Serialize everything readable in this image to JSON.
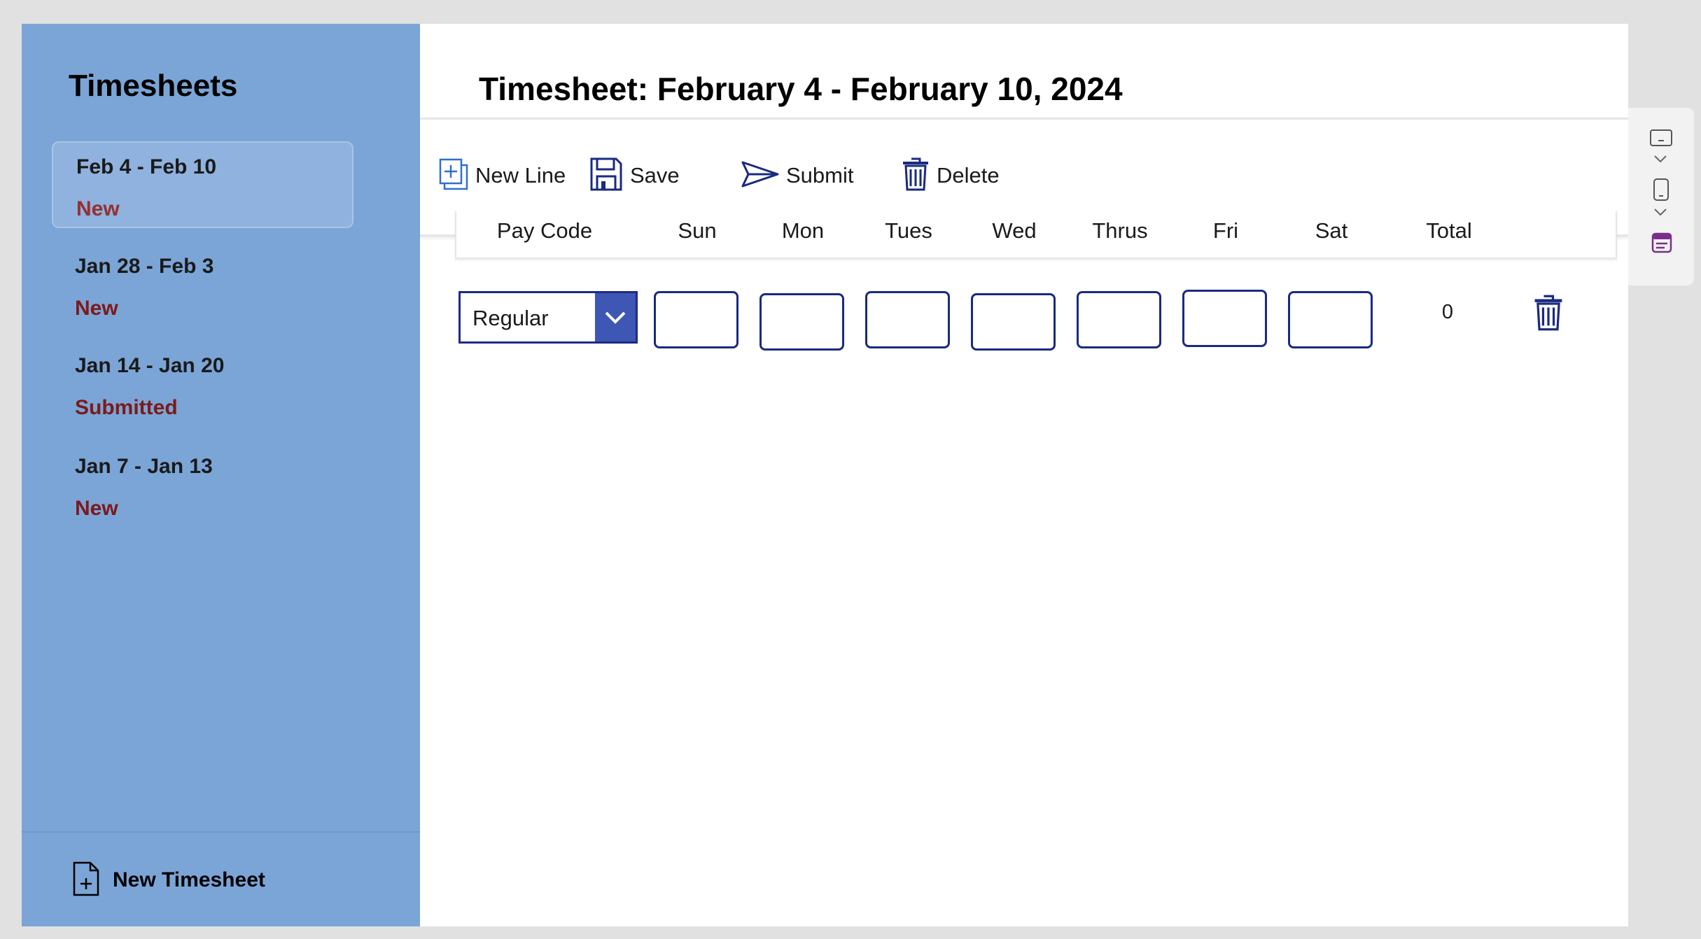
{
  "sidebar": {
    "title": "Timesheets",
    "items": [
      {
        "range": "Feb 4 - Feb 10",
        "status": "New"
      },
      {
        "range": "Jan 28 - Feb 3",
        "status": "New"
      },
      {
        "range": "Jan 14 - Jan 20",
        "status": "Submitted"
      },
      {
        "range": "Jan 7 - Jan 13",
        "status": "New"
      }
    ],
    "new_timesheet_label": "New Timesheet"
  },
  "main": {
    "title": "Timesheet: February 4 - February 10, 2024",
    "toolbar": {
      "new_line": "New Line",
      "save": "Save",
      "submit": "Submit",
      "delete": "Delete"
    },
    "columns": [
      "Pay Code",
      "Sun",
      "Mon",
      "Tues",
      "Wed",
      "Thrus",
      "Fri",
      "Sat",
      "Total"
    ],
    "row": {
      "pay_code": "Regular",
      "hours": [
        "",
        "",
        "",
        "",
        "",
        "",
        ""
      ],
      "total": "0"
    }
  },
  "colors": {
    "sidebar_bg": "#7ba5d6",
    "status_text": "#7c1a1a",
    "accent_navy": "#1a2a80",
    "dropdown_button": "#3e56b4"
  }
}
